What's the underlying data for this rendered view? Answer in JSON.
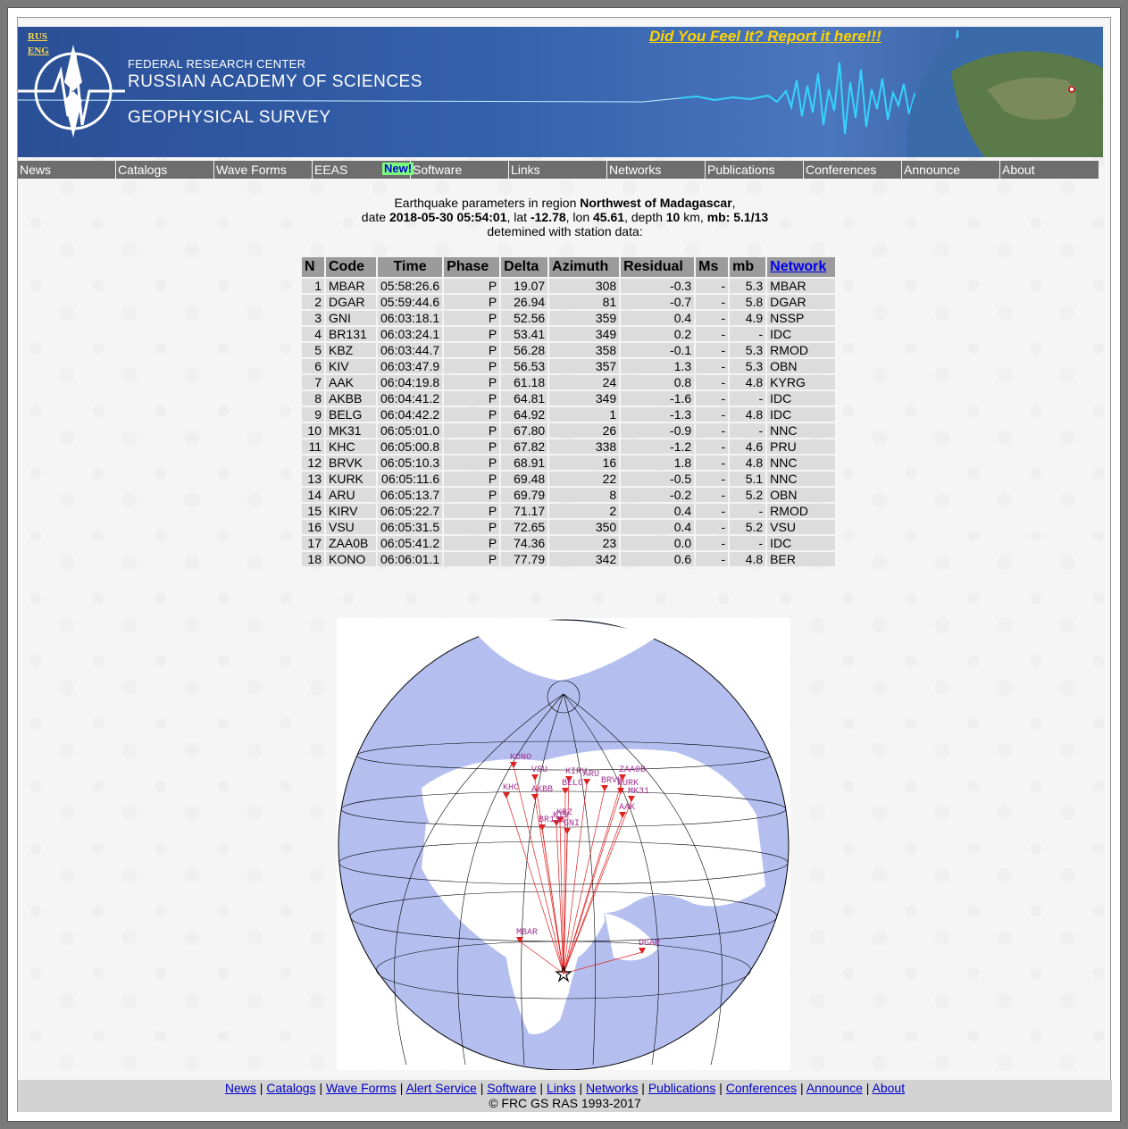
{
  "lang": {
    "rus": "RUS",
    "eng": "ENG"
  },
  "banner": {
    "line1": "FEDERAL RESEARCH CENTER",
    "line2": "RUSSIAN ACADEMY OF SCIENCES",
    "line3": "GEOPHYSICAL SURVEY",
    "report_link": "Did You Feel It? Report it here!!!"
  },
  "nav": {
    "items": [
      "News",
      "Catalogs",
      "Wave Forms",
      "EEAS",
      "New!",
      "Software",
      "Links",
      "Networks",
      "Publications",
      "Conferences",
      "Announce",
      "About"
    ]
  },
  "event": {
    "intro": "Earthquake parameters in region ",
    "region": "Northwest of Madagascar",
    "date_label": "date ",
    "date": "2018-05-30 05:54:01",
    "lat_label": ", lat ",
    "lat": "-12.78",
    "lon_label": ", lon ",
    "lon": "45.61",
    "depth_label": ", depth ",
    "depth": "10",
    "km_label": " km, ",
    "mb_label": "mb: ",
    "mb": "5.1/13",
    "outro": "detemined with station data:"
  },
  "table": {
    "headers": [
      "N",
      "Code",
      "Time",
      "Phase",
      "Delta",
      "Azimuth",
      "Residual",
      "Ms",
      "mb",
      "Network"
    ],
    "rows": [
      [
        "1",
        "MBAR",
        "05:58:26.6",
        "P",
        "19.07",
        "308",
        "-0.3",
        "-",
        "5.3",
        "MBAR"
      ],
      [
        "2",
        "DGAR",
        "05:59:44.6",
        "P",
        "26.94",
        "81",
        "-0.7",
        "-",
        "5.8",
        "DGAR"
      ],
      [
        "3",
        "GNI",
        "06:03:18.1",
        "P",
        "52.56",
        "359",
        "0.4",
        "-",
        "4.9",
        "NSSP"
      ],
      [
        "4",
        "BR131",
        "06:03:24.1",
        "P",
        "53.41",
        "349",
        "0.2",
        "-",
        "-",
        "IDC"
      ],
      [
        "5",
        "KBZ",
        "06:03:44.7",
        "P",
        "56.28",
        "358",
        "-0.1",
        "-",
        "5.3",
        "RMOD"
      ],
      [
        "6",
        "KIV",
        "06:03:47.9",
        "P",
        "56.53",
        "357",
        "1.3",
        "-",
        "5.3",
        "OBN"
      ],
      [
        "7",
        "AAK",
        "06:04:19.8",
        "P",
        "61.18",
        "24",
        "0.8",
        "-",
        "4.8",
        "KYRG"
      ],
      [
        "8",
        "AKBB",
        "06:04:41.2",
        "P",
        "64.81",
        "349",
        "-1.6",
        "-",
        "-",
        "IDC"
      ],
      [
        "9",
        "BELG",
        "06:04:42.2",
        "P",
        "64.92",
        "1",
        "-1.3",
        "-",
        "4.8",
        "IDC"
      ],
      [
        "10",
        "MK31",
        "06:05:01.0",
        "P",
        "67.80",
        "26",
        "-0.9",
        "-",
        "-",
        "NNC"
      ],
      [
        "11",
        "KHC",
        "06:05:00.8",
        "P",
        "67.82",
        "338",
        "-1.2",
        "-",
        "4.6",
        "PRU"
      ],
      [
        "12",
        "BRVK",
        "06:05:10.3",
        "P",
        "68.91",
        "16",
        "1.8",
        "-",
        "4.8",
        "NNC"
      ],
      [
        "13",
        "KURK",
        " 06:05:11.6",
        "P",
        "69.48",
        "22",
        "-0.5",
        "-",
        "5.1",
        "NNC"
      ],
      [
        "14",
        "ARU",
        "06:05:13.7",
        "P",
        "69.79",
        "8",
        "-0.2",
        "-",
        "5.2",
        "OBN"
      ],
      [
        "15",
        "KIRV",
        "06:05:22.7",
        "P",
        "71.17",
        "2",
        "0.4",
        "-",
        "-",
        "RMOD"
      ],
      [
        "16",
        "VSU",
        "06:05:31.5",
        "P",
        "72.65",
        "350",
        "0.4",
        "-",
        "5.2",
        "VSU"
      ],
      [
        "17",
        "ZAA0B",
        "06:05:41.2",
        "P",
        "74.36",
        "23",
        "0.0",
        "-",
        "-",
        "IDC"
      ],
      [
        "18",
        "KONO",
        "06:06:01.1",
        "P",
        "77.79",
        "342",
        "0.6",
        "-",
        "4.8",
        "BER"
      ]
    ]
  },
  "map": {
    "stations": [
      "KONO",
      "VSU",
      "KIRV",
      "ARU",
      "BRVK",
      "ZAA0B",
      "KURK",
      "KHC",
      "AKBB",
      "BELG",
      "MK31",
      "AAK",
      "KBZ",
      "KIV",
      "BR131",
      "GNI",
      "MBAR",
      "DGAR"
    ],
    "ocean_color": "#b4bff0",
    "land_color": "#ffffff",
    "ray_color": "#e02020"
  },
  "footer": {
    "links": [
      "News",
      "Catalogs",
      "Wave Forms",
      "Alert Service",
      "Software",
      "Links",
      "Networks",
      "Publications",
      "Conferences",
      "Announce",
      "About"
    ],
    "copyright": "© FRC GS RAS 1993-2017"
  }
}
